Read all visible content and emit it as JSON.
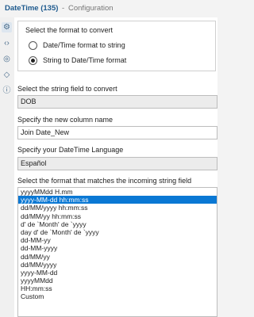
{
  "window": {
    "title_bold": "DateTime (135)",
    "title_sep": "-",
    "title_rest": "Configuration"
  },
  "sidebar": {
    "icons": [
      "gear-icon",
      "code-icon",
      "target-icon",
      "tag-icon",
      "help-icon"
    ],
    "active_index": 0
  },
  "format_group": {
    "title": "Select the format to convert",
    "options": [
      "Date/Time format to string",
      "String to Date/Time format"
    ],
    "selected_index": 1
  },
  "string_field": {
    "label": "Select the string field to convert",
    "value": "DOB"
  },
  "new_column": {
    "label": "Specify the new column name",
    "value": "Join Date_New"
  },
  "language": {
    "label": "Specify your DateTime Language",
    "value": "Español"
  },
  "format_list": {
    "label": "Select the format that matches the incoming string field",
    "items": [
      "yyyyMMdd H.mm",
      "yyyy-MM-dd hh:mm:ss",
      "dd/MM/yyyy hh:mm:ss",
      "dd/MM/yy hh:mm:ss",
      "d' de `Month' de `yyyy",
      "day d' de `Month' de `yyyy",
      "dd-MM-yy",
      "dd-MM-yyyy",
      "dd/MM/yy",
      "dd/MM/yyyy",
      "yyyy-MM-dd",
      "yyyyMMdd",
      "HH:mm:ss",
      "Custom"
    ],
    "selected_index": 1
  },
  "colors": {
    "accent": "#0a78d4",
    "title": "#1e5a8e"
  }
}
